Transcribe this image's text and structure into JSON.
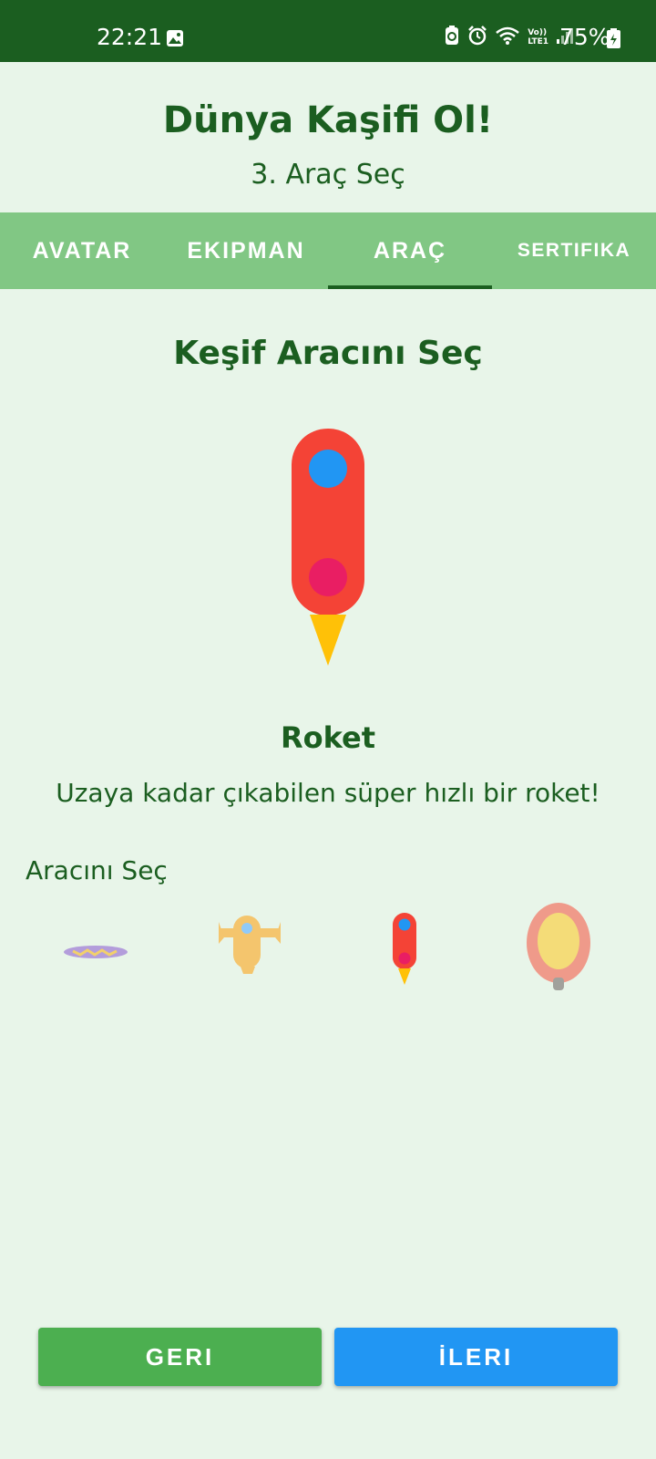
{
  "status_bar": {
    "time": "22:21",
    "battery_percent": "75%",
    "icons": [
      "gallery-icon",
      "recycle-icon",
      "alarm-icon",
      "wifi-icon",
      "volte-icon",
      "signal-icon",
      "battery-icon"
    ],
    "volte_text_line1": "Vo))",
    "volte_text_line2": "LTE1"
  },
  "header": {
    "title": "Dünya Kaşifi Ol!",
    "step": "3. Araç Seç"
  },
  "tabs": [
    {
      "label": "AVATAR",
      "active": false
    },
    {
      "label": "EKIPMAN",
      "active": false
    },
    {
      "label": "ARAÇ",
      "active": true
    },
    {
      "label": "SERTIFIKA",
      "active": false
    }
  ],
  "main": {
    "section_title": "Keşif Aracını Seç",
    "selected_vehicle": {
      "name": "Roket",
      "description": "Uzaya kadar çıkabilen süper hızlı bir roket!",
      "icon": "rocket-icon"
    },
    "choose_label": "Aracını Seç",
    "options": [
      {
        "icon": "flying-carpet-icon",
        "selected": false
      },
      {
        "icon": "airplane-icon",
        "selected": false
      },
      {
        "icon": "rocket-icon",
        "selected": true
      },
      {
        "icon": "hot-air-balloon-icon",
        "selected": false
      }
    ]
  },
  "buttons": {
    "back_label": "GERI",
    "next_label": "İLERI"
  },
  "colors": {
    "primary_dark": "#1B5E20",
    "background": "#E8F5E9",
    "tab_bar": "#81C784",
    "back_button": "#4CAF50",
    "next_button": "#2196F3",
    "rocket_body": "#F44336",
    "rocket_window": "#2196F3",
    "rocket_dot": "#E91E63",
    "rocket_flame": "#FFC107"
  }
}
